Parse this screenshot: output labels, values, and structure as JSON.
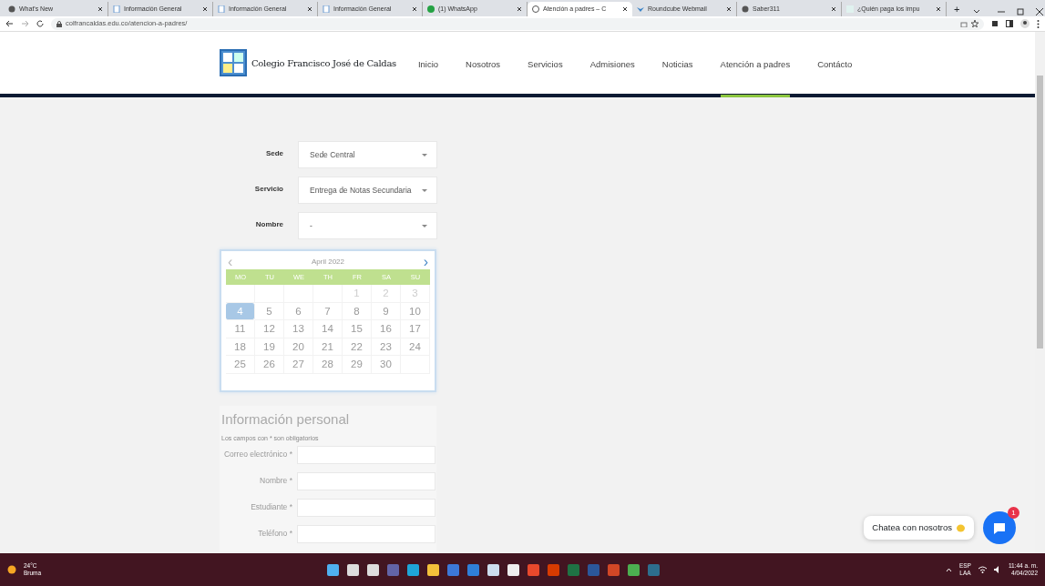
{
  "browser": {
    "tabs": [
      {
        "title": "What's New",
        "selected": false
      },
      {
        "title": "Información General",
        "selected": false
      },
      {
        "title": "Información General",
        "selected": false
      },
      {
        "title": "Información General",
        "selected": false
      },
      {
        "title": "(1) WhatsApp",
        "selected": false
      },
      {
        "title": "Atención a padres – C",
        "selected": true
      },
      {
        "title": "Roundcube Webmail",
        "selected": false
      },
      {
        "title": "Saber311",
        "selected": false
      },
      {
        "title": "¿Quién paga los impu",
        "selected": false
      }
    ],
    "new_tab": "+",
    "address": "colfrancaldas.edu.co/atencion-a-padres/"
  },
  "site": {
    "logo_text": "Colegio Francisco José de Caldas",
    "nav": [
      {
        "label": "Inicio",
        "selected": false
      },
      {
        "label": "Nosotros",
        "selected": false
      },
      {
        "label": "Servicios",
        "selected": false
      },
      {
        "label": "Admisiones",
        "selected": false
      },
      {
        "label": "Noticias",
        "selected": false
      },
      {
        "label": "Atención a padres",
        "selected": true
      },
      {
        "label": "Contácto",
        "selected": false
      }
    ]
  },
  "selects": [
    {
      "label": "Sede",
      "value": "Sede Central"
    },
    {
      "label": "Servicio",
      "value": "Entrega de Notas Secundaria"
    },
    {
      "label": "Nombre",
      "value": "-"
    }
  ],
  "calendar": {
    "title": "April 2022",
    "prev": "‹",
    "next": "›",
    "weekdays": [
      "MO",
      "TU",
      "WE",
      "TH",
      "FR",
      "SA",
      "SU"
    ],
    "weeks": [
      [
        {
          "day": "1",
          "disabled": true,
          "selected": false
        },
        {
          "day": "2",
          "disabled": true,
          "selected": false
        },
        {
          "day": "3",
          "disabled": true,
          "selected": false
        }
      ],
      [
        {
          "day": "4",
          "disabled": false,
          "selected": true
        },
        {
          "day": "5",
          "disabled": false,
          "selected": false
        },
        {
          "day": "6",
          "disabled": false,
          "selected": false
        },
        {
          "day": "7",
          "disabled": false,
          "selected": false
        },
        {
          "day": "8",
          "disabled": false,
          "selected": false
        },
        {
          "day": "9",
          "disabled": false,
          "selected": false
        },
        {
          "day": "10",
          "disabled": false,
          "selected": false
        }
      ],
      [
        {
          "day": "11",
          "disabled": false,
          "selected": false
        },
        {
          "day": "12",
          "disabled": false,
          "selected": false
        },
        {
          "day": "13",
          "disabled": false,
          "selected": false
        },
        {
          "day": "14",
          "disabled": false,
          "selected": false
        },
        {
          "day": "15",
          "disabled": false,
          "selected": false
        },
        {
          "day": "16",
          "disabled": false,
          "selected": false
        },
        {
          "day": "17",
          "disabled": false,
          "selected": false
        }
      ],
      [
        {
          "day": "18",
          "disabled": false,
          "selected": false
        },
        {
          "day": "19",
          "disabled": false,
          "selected": false
        },
        {
          "day": "20",
          "disabled": false,
          "selected": false
        },
        {
          "day": "21",
          "disabled": false,
          "selected": false
        },
        {
          "day": "22",
          "disabled": false,
          "selected": false
        },
        {
          "day": "23",
          "disabled": false,
          "selected": false
        },
        {
          "day": "24",
          "disabled": false,
          "selected": false
        }
      ],
      [
        {
          "day": "25",
          "disabled": false,
          "selected": false
        },
        {
          "day": "26",
          "disabled": false,
          "selected": false
        },
        {
          "day": "27",
          "disabled": false,
          "selected": false
        },
        {
          "day": "28",
          "disabled": false,
          "selected": false
        },
        {
          "day": "29",
          "disabled": false,
          "selected": false
        },
        {
          "day": "30",
          "disabled": false,
          "selected": false
        }
      ]
    ]
  },
  "personal": {
    "title": "Información personal",
    "note": "Los campos con * son obligatorios",
    "fields": [
      {
        "label": "Correo electrónico *"
      },
      {
        "label": "Nombre *"
      },
      {
        "label": "Estudiante *"
      },
      {
        "label": "Teléfono *"
      }
    ]
  },
  "chat": {
    "label": "Chatea con nosotros",
    "badge": "1"
  },
  "taskbar": {
    "temperature": "24°C",
    "weather": "Bruma",
    "language": "ESP",
    "layout": "LAA",
    "time": "11:44 a. m.",
    "date": "4/04/2022"
  }
}
